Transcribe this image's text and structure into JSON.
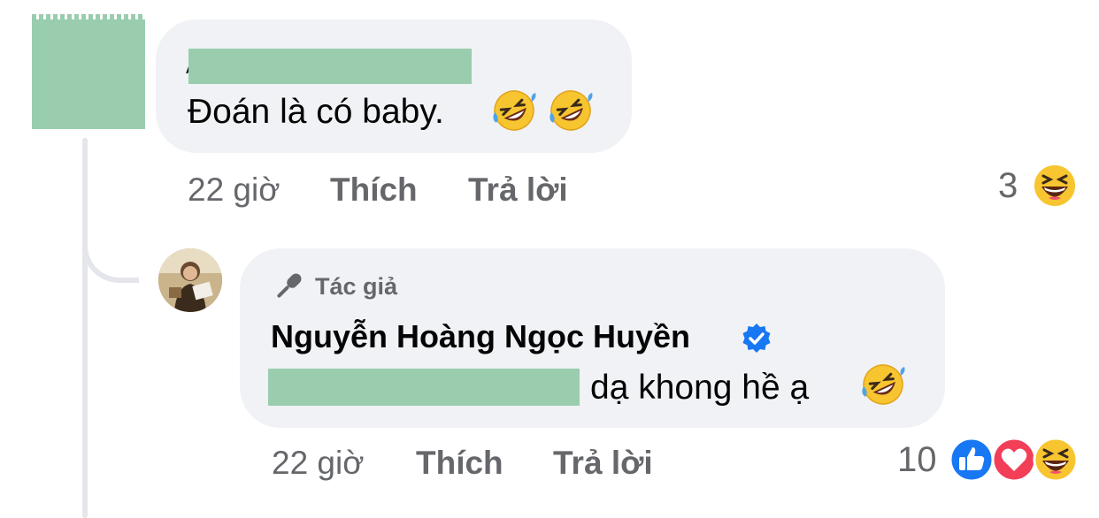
{
  "comment1": {
    "text": "Đoán là có baby.",
    "emoji_icons": [
      "rolling-on-floor-laughing-icon",
      "rolling-on-floor-laughing-icon"
    ],
    "time": "22 giờ",
    "like_label": "Thích",
    "reply_label": "Trả lời",
    "reaction_count": "3",
    "reactions": [
      "haha-icon"
    ]
  },
  "reply": {
    "author_badge": "Tác giả",
    "author_name": "Nguyễn Hoàng Ngọc Huyền",
    "text": "dạ khong hề ạ",
    "emoji_icons": [
      "rolling-on-floor-laughing-icon"
    ],
    "time": "22 giờ",
    "like_label": "Thích",
    "reply_label": "Trả lời",
    "reaction_count": "10",
    "reactions": [
      "like-icon",
      "love-icon",
      "haha-icon"
    ]
  },
  "colors": {
    "bubble": "#f0f2f5",
    "meta_text": "#65676b",
    "redaction": "#99cdae",
    "verified": "#1877f2"
  }
}
